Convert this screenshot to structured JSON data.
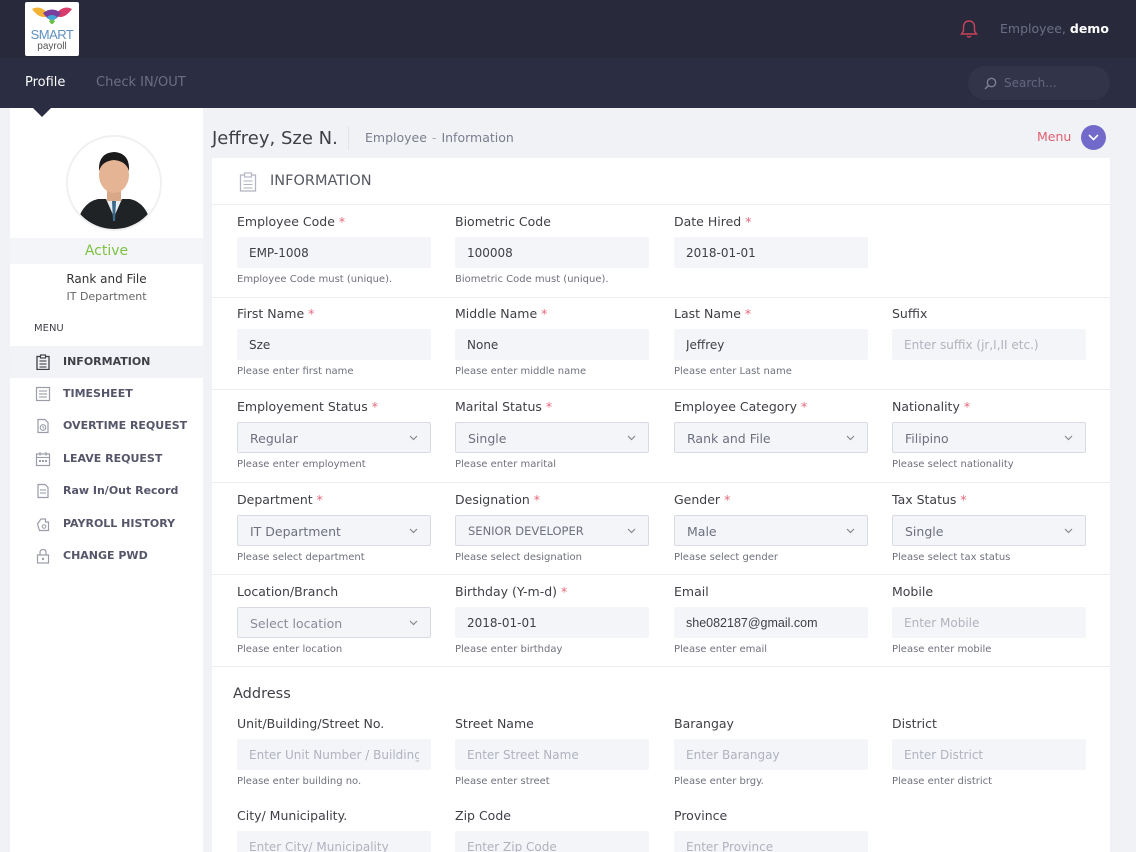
{
  "brand": {
    "logo_text": "SMART",
    "logo_subtext": "payroll"
  },
  "header": {
    "user_prefix": "Employee,",
    "user_name": "demo"
  },
  "nav": {
    "profile": "Profile",
    "check": "Check IN/OUT",
    "search_placeholder": "Search..."
  },
  "profile": {
    "status": "Active",
    "rank": "Rank and File",
    "department": "IT Department"
  },
  "sidebar": {
    "menu_heading": "MENU",
    "items": [
      {
        "label": "INFORMATION",
        "icon": "clipboard-list-icon"
      },
      {
        "label": "TIMESHEET",
        "icon": "list-icon"
      },
      {
        "label": "OVERTIME REQUEST",
        "icon": "clock-document-icon"
      },
      {
        "label": "LEAVE REQUEST",
        "icon": "calendar-icon"
      },
      {
        "label": "Raw In/Out Record",
        "icon": "document-icon"
      },
      {
        "label": "PAYROLL HISTORY",
        "icon": "money-icon"
      },
      {
        "label": "CHANGE PWD",
        "icon": "lock-icon"
      }
    ]
  },
  "page": {
    "title": "Jeffrey, Sze N.",
    "breadcrumb_1": "Employee",
    "breadcrumb_sep": "-",
    "breadcrumb_2": "Information",
    "menu_label": "Menu"
  },
  "card": {
    "title": "INFORMATION",
    "address_title": "Address"
  },
  "fields": {
    "employee_code": {
      "label": "Employee Code",
      "required": "*",
      "value": "EMP-1008",
      "help": "Employee Code must (unique)."
    },
    "biometric_code": {
      "label": "Biometric Code",
      "value": "100008",
      "help": "Biometric Code must (unique)."
    },
    "date_hired": {
      "label": "Date Hired",
      "required": "*",
      "value": "2018-01-01"
    },
    "first_name": {
      "label": "First Name",
      "required": "*",
      "value": "Sze",
      "help": "Please enter first name"
    },
    "middle_name": {
      "label": "Middle Name",
      "required": "*",
      "value": "None",
      "help": "Please enter middle name"
    },
    "last_name": {
      "label": "Last Name",
      "required": "*",
      "value": "Jeffrey",
      "help": "Please enter Last name"
    },
    "suffix": {
      "label": "Suffix",
      "placeholder": "Enter suffix (jr,I,II etc.)"
    },
    "employment_status": {
      "label": "Employement Status",
      "required": "*",
      "value": "Regular",
      "help": "Please enter employment"
    },
    "marital_status": {
      "label": "Marital Status",
      "required": "*",
      "value": "Single",
      "help": "Please enter marital"
    },
    "employee_category": {
      "label": "Employee Category",
      "required": "*",
      "value": "Rank and File"
    },
    "nationality": {
      "label": "Nationality",
      "required": "*",
      "value": "Filipino",
      "help": "Please select nationality"
    },
    "department": {
      "label": "Department",
      "required": "*",
      "value": "IT Department",
      "help": "Please select department"
    },
    "designation": {
      "label": "Designation",
      "required": "*",
      "value": "SENIOR DEVELOPER",
      "help": "Please select designation"
    },
    "gender": {
      "label": "Gender",
      "required": "*",
      "value": "Male",
      "help": "Please select gender"
    },
    "tax_status": {
      "label": "Tax Status",
      "required": "*",
      "value": "Single",
      "help": "Please select tax status"
    },
    "location": {
      "label": "Location/Branch",
      "value": "Select location",
      "help": "Please enter location"
    },
    "birthday": {
      "label": "Birthday (Y-m-d)",
      "required": "*",
      "value": "2018-01-01",
      "help": "Please enter birthday"
    },
    "email": {
      "label": "Email",
      "value": "she082187@gmail.com",
      "help": "Please enter email"
    },
    "mobile": {
      "label": "Mobile",
      "placeholder": "Enter Mobile",
      "help": "Please enter mobile"
    },
    "unit": {
      "label": "Unit/Building/Street No.",
      "placeholder": "Enter Unit Number / Building / St",
      "help": "Please enter building no."
    },
    "street": {
      "label": "Street Name",
      "placeholder": "Enter Street Name",
      "help": "Please enter street"
    },
    "barangay": {
      "label": "Barangay",
      "placeholder": "Enter Barangay",
      "help": "Please enter brgy."
    },
    "district": {
      "label": "District",
      "placeholder": "Enter District",
      "help": "Please enter district"
    },
    "city": {
      "label": "City/ Municipality.",
      "placeholder": "Enter City/ Municipality"
    },
    "zip": {
      "label": "Zip Code",
      "placeholder": "Enter Zip Code"
    },
    "province": {
      "label": "Province",
      "placeholder": "Enter Province"
    }
  },
  "colors": {
    "topbar": "#282a3c",
    "navbar": "#2b2d42",
    "accent": "#716aca",
    "active": "#7dc243",
    "required": "#e8677a"
  }
}
